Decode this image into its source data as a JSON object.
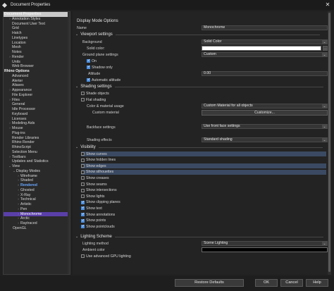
{
  "window": {
    "title": "Document Properties",
    "close_glyph": "✕"
  },
  "sidebar": {
    "items": [
      {
        "label": "Document Properties",
        "chev": "",
        "state": "header"
      },
      {
        "label": "Annotation Styles",
        "chev": "›",
        "state": ""
      },
      {
        "label": "Document User Text",
        "chev": "",
        "state": ""
      },
      {
        "label": "Grid",
        "chev": "",
        "state": ""
      },
      {
        "label": "Hatch",
        "chev": "",
        "state": ""
      },
      {
        "label": "Linetypes",
        "chev": "",
        "state": ""
      },
      {
        "label": "Location",
        "chev": "",
        "state": ""
      },
      {
        "label": "Mesh",
        "chev": "",
        "state": ""
      },
      {
        "label": "Notes",
        "chev": "",
        "state": ""
      },
      {
        "label": "Render",
        "chev": "›",
        "state": ""
      },
      {
        "label": "Units",
        "chev": "",
        "state": ""
      },
      {
        "label": "Web Browser",
        "chev": "",
        "state": ""
      },
      {
        "label": "Rhino Options",
        "chev": "",
        "state": "header"
      },
      {
        "label": "Advanced",
        "chev": "",
        "state": ""
      },
      {
        "label": "Alerter",
        "chev": "",
        "state": ""
      },
      {
        "label": "Aliases",
        "chev": "",
        "state": ""
      },
      {
        "label": "Appearance",
        "chev": "›",
        "state": ""
      },
      {
        "label": "File Explorer",
        "chev": "",
        "state": ""
      },
      {
        "label": "Files",
        "chev": "›",
        "state": ""
      },
      {
        "label": "General",
        "chev": "",
        "state": ""
      },
      {
        "label": "Idle Processor",
        "chev": "",
        "state": ""
      },
      {
        "label": "Keyboard",
        "chev": "",
        "state": ""
      },
      {
        "label": "Licenses",
        "chev": "",
        "state": ""
      },
      {
        "label": "Modeling Aids",
        "chev": "›",
        "state": ""
      },
      {
        "label": "Mouse",
        "chev": "›",
        "state": ""
      },
      {
        "label": "Plug-ins",
        "chev": "",
        "state": ""
      },
      {
        "label": "Render Libraries",
        "chev": "",
        "state": ""
      },
      {
        "label": "Rhino Render",
        "chev": "",
        "state": ""
      },
      {
        "label": "RhinoScript",
        "chev": "",
        "state": ""
      },
      {
        "label": "Selection Menu",
        "chev": "",
        "state": ""
      },
      {
        "label": "Toolbars",
        "chev": "›",
        "state": ""
      },
      {
        "label": "Updates and Statistics",
        "chev": "",
        "state": ""
      },
      {
        "label": "View",
        "chev": "⌄",
        "state": ""
      },
      {
        "label": "Display Modes",
        "chev": "⌄",
        "state": ""
      },
      {
        "label": "Wireframe",
        "chev": "›",
        "state": ""
      },
      {
        "label": "Shaded",
        "chev": "›",
        "state": ""
      },
      {
        "label": "Rendered",
        "chev": "›",
        "state": "blue"
      },
      {
        "label": "Ghosted",
        "chev": "›",
        "state": ""
      },
      {
        "label": "X-Ray",
        "chev": "›",
        "state": ""
      },
      {
        "label": "Technical",
        "chev": "›",
        "state": ""
      },
      {
        "label": "Artistic",
        "chev": "›",
        "state": ""
      },
      {
        "label": "Pen",
        "chev": "›",
        "state": ""
      },
      {
        "label": "Monochrome",
        "chev": "›",
        "state": "highlight"
      },
      {
        "label": "Arctic",
        "chev": "›",
        "state": ""
      },
      {
        "label": "Raytraced",
        "chev": "›",
        "state": ""
      },
      {
        "label": "OpenGL",
        "chev": "",
        "state": ""
      }
    ]
  },
  "main": {
    "heading": "Display Mode Options",
    "name_label": "Name",
    "name_value": "Monochrome",
    "viewport": {
      "title": "Viewport settings",
      "background_label": "Background",
      "background_value": "Solid Color",
      "solid_color_label": "Solid color:",
      "ground_plane_label": "Ground plane settings",
      "ground_plane_value": "Custom",
      "on_label": "On",
      "shadow_only_label": "Shadow only",
      "altitude_label": "Altitude",
      "altitude_value": "0.00",
      "automatic_altitude_label": "Automatic altitude"
    },
    "shading": {
      "title": "Shading settings",
      "shade_objects_label": "Shade objects",
      "flat_shading_label": "Flat shading",
      "color_material_label": "Color & material usage",
      "color_material_value": "Custom Material for all objects",
      "custom_material_label": "Custom material",
      "customize_button": "Customize...",
      "backface_label": "Backface settings",
      "backface_value": "Use front face settings",
      "shading_effects_label": "Shading effects",
      "shading_effects_value": "Standard shading"
    },
    "visibility": {
      "title": "Visibility",
      "items": [
        {
          "label": "Show curves",
          "checked": false,
          "selected": true
        },
        {
          "label": "Show hidden lines",
          "checked": false,
          "selected": false
        },
        {
          "label": "Show edges",
          "checked": false,
          "selected": true
        },
        {
          "label": "Show silhouettes",
          "checked": false,
          "selected": true
        },
        {
          "label": "Show creases",
          "checked": false,
          "selected": false
        },
        {
          "label": "Show seams",
          "checked": false,
          "selected": false
        },
        {
          "label": "Show intersections",
          "checked": false,
          "selected": false
        },
        {
          "label": "Show lights",
          "checked": false,
          "selected": false
        },
        {
          "label": "Show clipping planes",
          "checked": true,
          "selected": false
        },
        {
          "label": "Show text",
          "checked": true,
          "selected": false
        },
        {
          "label": "Show annotations",
          "checked": true,
          "selected": false
        },
        {
          "label": "Show points",
          "checked": true,
          "selected": false
        },
        {
          "label": "Show pointclouds",
          "checked": true,
          "selected": false
        }
      ]
    },
    "lighting": {
      "title": "Lighting Scheme",
      "method_label": "Lighting method",
      "method_value": "Scene Lighting",
      "ambient_label": "Ambient color",
      "gpu_label": "Use advanced GPU lighting"
    }
  },
  "footer": {
    "restore_defaults": "Restore Defaults",
    "ok": "OK",
    "cancel": "Cancel",
    "help": "Help"
  },
  "icons": {
    "dropdown": "⌄",
    "more": "…"
  },
  "colors": {
    "accent": "#4c8fe0",
    "selection": "#5a3fa8",
    "row_select": "#3b4a62"
  }
}
